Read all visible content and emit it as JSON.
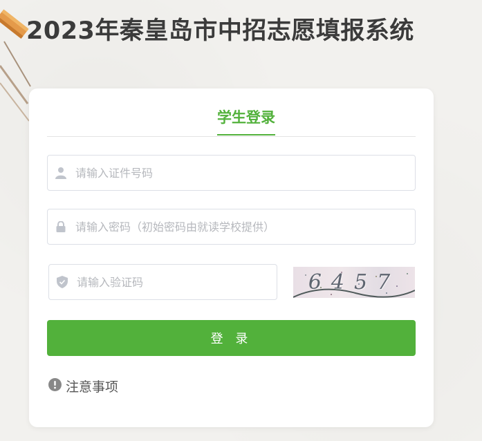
{
  "page": {
    "title": "2023年秦皇岛市中招志愿填报系统"
  },
  "login": {
    "tab_label": "学生登录",
    "id_field": {
      "placeholder": "请输入证件号码",
      "icon": "user-icon"
    },
    "password_field": {
      "placeholder": "请输入密码（初始密码由就读学校提供）",
      "icon": "lock-icon"
    },
    "captcha_field": {
      "placeholder": "请输入验证码",
      "icon": "shield-icon"
    },
    "captcha_image_text": "6457",
    "submit_label": "登 录",
    "notice_label": "注意事项",
    "notice_icon": "exclamation-circle-icon"
  },
  "colors": {
    "accent": "#52b13b",
    "title": "#3b3b3b",
    "placeholder": "#b6b8bd",
    "border": "#dcdfe6"
  }
}
